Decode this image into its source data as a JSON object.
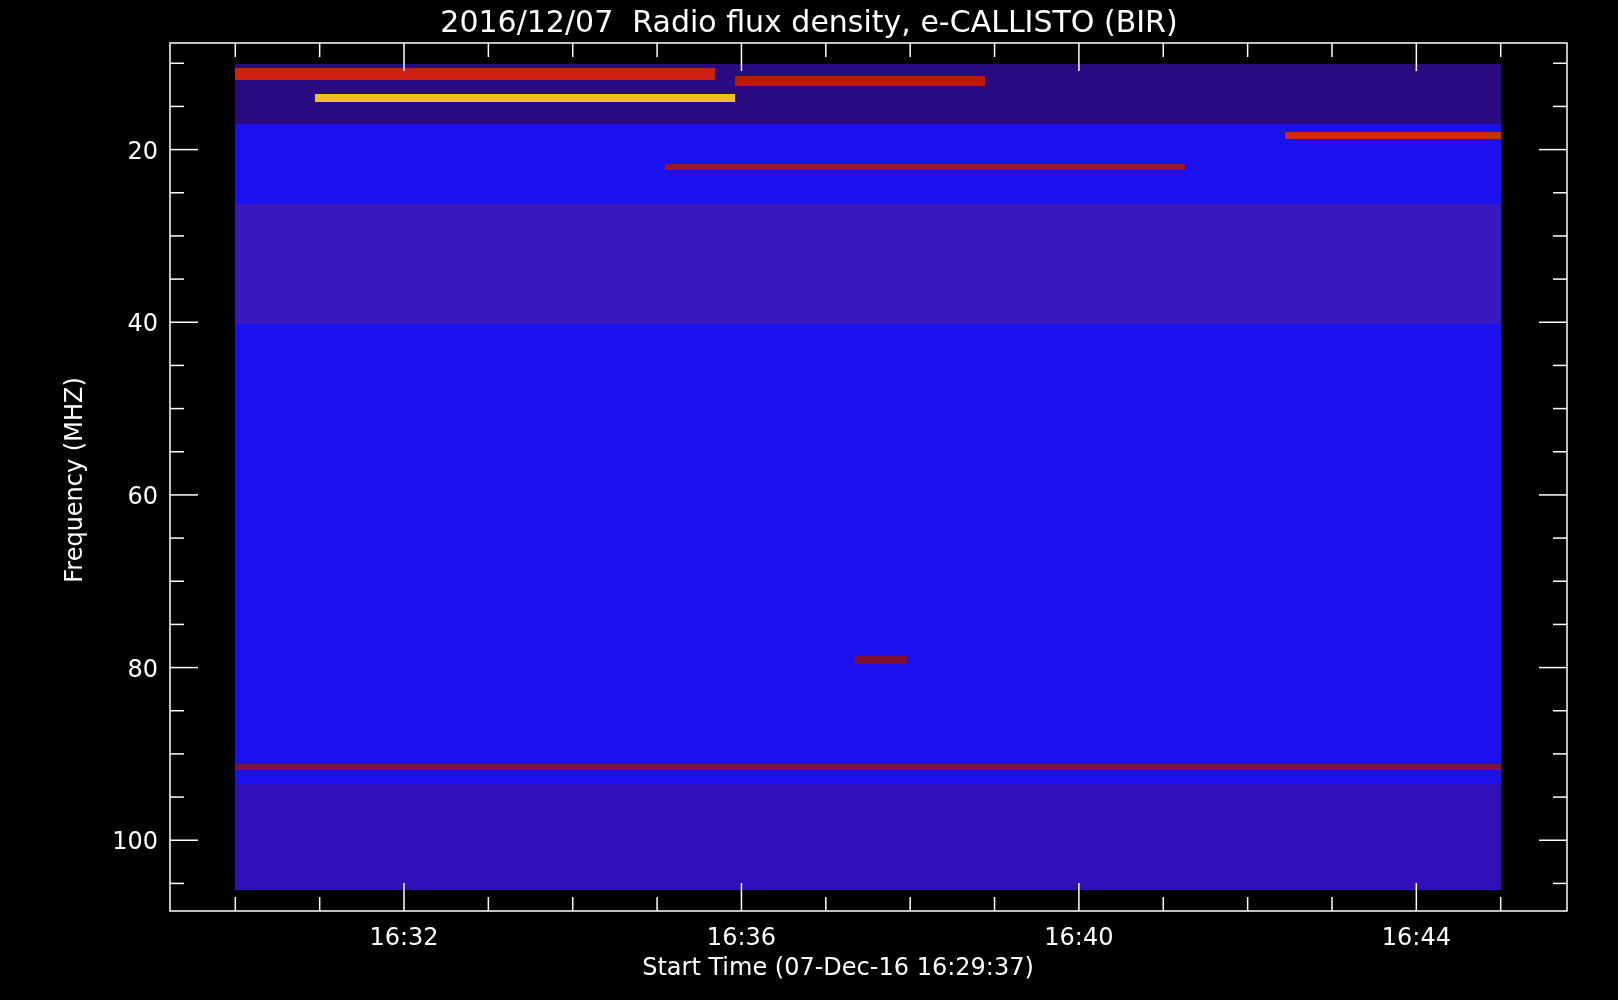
{
  "title": "2016/12/07  Radio flux density, e-CALLISTO (BIR)",
  "y_axis": {
    "label": "Frequency (MHZ)",
    "ticks": [
      "20",
      "40",
      "60",
      "80",
      "100"
    ]
  },
  "x_axis": {
    "label": "Start Time (07-Dec-16 16:29:37)",
    "ticks": [
      "16:32",
      "16:36",
      "16:40",
      "16:44"
    ]
  }
}
